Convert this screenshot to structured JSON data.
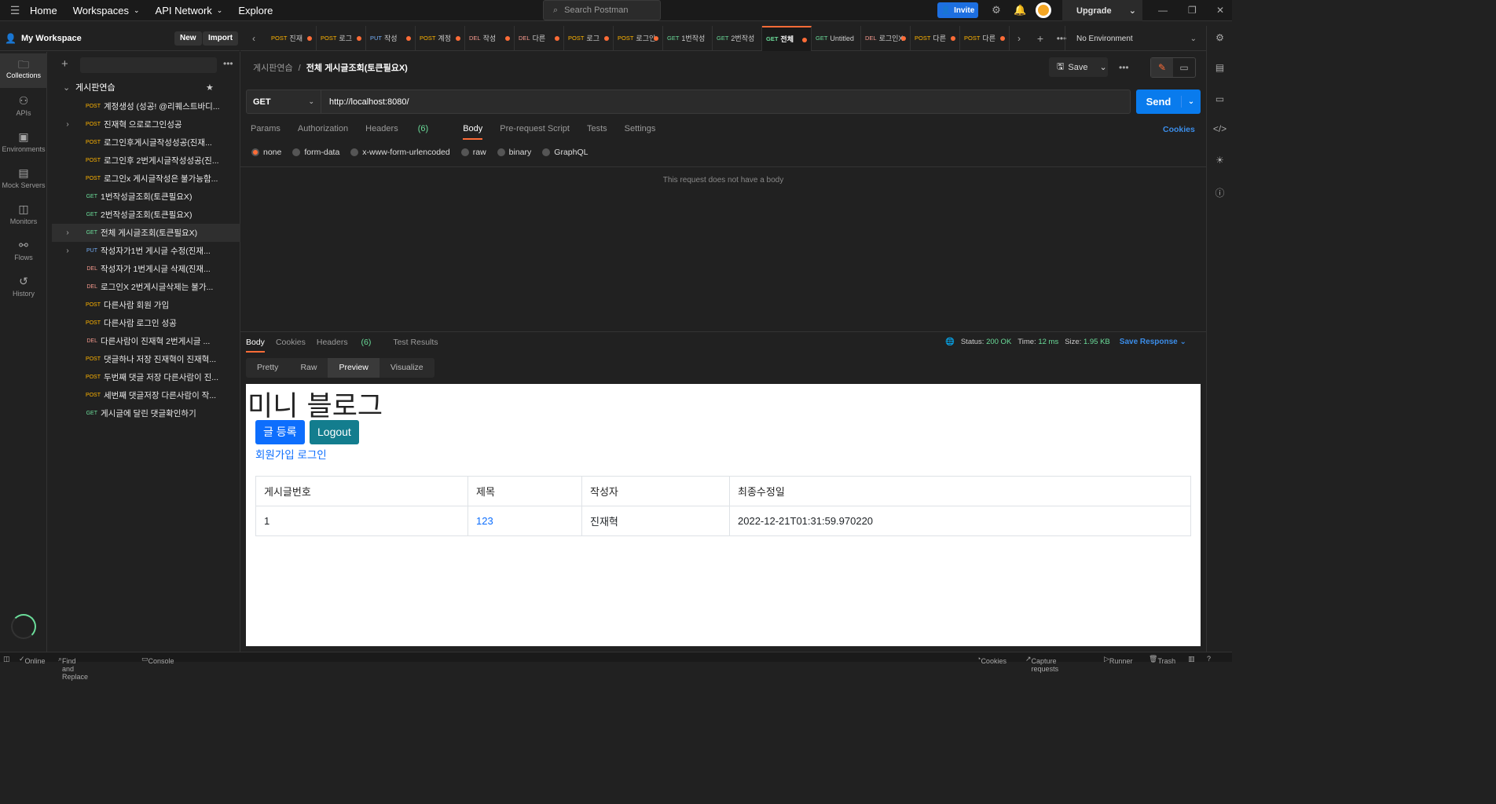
{
  "topbar": {
    "home": "Home",
    "workspaces": "Workspaces",
    "api_network": "API Network",
    "explore": "Explore",
    "search_placeholder": "Search Postman",
    "invite": "Invite",
    "upgrade": "Upgrade"
  },
  "workspace": {
    "name": "My Workspace",
    "new_label": "New",
    "import_label": "Import"
  },
  "leftnav": [
    {
      "label": "Collections",
      "icon": "collections-icon"
    },
    {
      "label": "APIs",
      "icon": "apis-icon"
    },
    {
      "label": "Environments",
      "icon": "environments-icon"
    },
    {
      "label": "Mock Servers",
      "icon": "mock-servers-icon"
    },
    {
      "label": "Monitors",
      "icon": "monitors-icon"
    },
    {
      "label": "Flows",
      "icon": "flows-icon"
    },
    {
      "label": "History",
      "icon": "history-icon"
    }
  ],
  "collection": {
    "name": "게시판연습",
    "requests": [
      {
        "method": "POST",
        "name": "계정생성 (성공! @리퀘스트바디..."
      },
      {
        "method": "POST",
        "name": "진재혁 으로로그인성공",
        "expand": true
      },
      {
        "method": "POST",
        "name": "로그인후게시글작성성공(진재..."
      },
      {
        "method": "POST",
        "name": "로그인후 2번게시글작성성공(진..."
      },
      {
        "method": "POST",
        "name": "로그인x 게시글작성은 불가능함..."
      },
      {
        "method": "GET",
        "name": "1번작성글조회(토큰필요X)"
      },
      {
        "method": "GET",
        "name": "2번작성글조회(토큰필요X)"
      },
      {
        "method": "GET",
        "name": "전체 게시글조회(토큰필요X)",
        "expand": true,
        "active": true
      },
      {
        "method": "PUT",
        "name": "작성자가1번 게시글 수정(진재...",
        "expand": true
      },
      {
        "method": "DEL",
        "name": "작성자가 1번게시글 삭제(진재..."
      },
      {
        "method": "DEL",
        "name": "로그인X 2번게시글삭제는 불가..."
      },
      {
        "method": "POST",
        "name": "다른사람 회원 가입"
      },
      {
        "method": "POST",
        "name": "다른사람 로그인 성공"
      },
      {
        "method": "DEL",
        "name": "다른사람이 진재혁 2번게시글 ..."
      },
      {
        "method": "POST",
        "name": "댓글하나 저장 진재혁이 진재혁..."
      },
      {
        "method": "POST",
        "name": "두번째 댓글 저장 다른사람이 진..."
      },
      {
        "method": "POST",
        "name": "세번째 댓글저장 다른사람이 작..."
      },
      {
        "method": "GET",
        "name": "게시글에 달린 댓글확인하기"
      }
    ]
  },
  "tabs": [
    {
      "method": "POST",
      "name": "진재"
    },
    {
      "method": "POST",
      "name": "로그"
    },
    {
      "method": "PUT",
      "name": "작성"
    },
    {
      "method": "POST",
      "name": "계정"
    },
    {
      "method": "DEL",
      "name": "작성"
    },
    {
      "method": "DEL",
      "name": "다른"
    },
    {
      "method": "POST",
      "name": "로그"
    },
    {
      "method": "POST",
      "name": "로그인"
    },
    {
      "method": "GET",
      "name": "1번작성"
    },
    {
      "method": "GET",
      "name": "2번작성"
    },
    {
      "method": "GET",
      "name": "전체",
      "active": true
    },
    {
      "method": "GET",
      "name": "Untitled"
    },
    {
      "method": "DEL",
      "name": "로그인X"
    },
    {
      "method": "POST",
      "name": "다른"
    },
    {
      "method": "POST",
      "name": "다른"
    }
  ],
  "environment": "No Environment",
  "request": {
    "breadcrumb_parent": "게시판연습",
    "breadcrumb_sep": "/",
    "title": "전체 게시글조회(토큰필요X)",
    "save": "Save",
    "method": "GET",
    "url": "http://localhost:8080/",
    "send": "Send",
    "tabs": {
      "params": "Params",
      "authorization": "Authorization",
      "headers": "Headers",
      "headers_count": "(6)",
      "body": "Body",
      "prerequest": "Pre-request Script",
      "tests": "Tests",
      "settings": "Settings"
    },
    "cookies": "Cookies",
    "body_types": [
      "none",
      "form-data",
      "x-www-form-urlencoded",
      "raw",
      "binary",
      "GraphQL"
    ],
    "no_body_text": "This request does not have a body"
  },
  "response": {
    "tabs": {
      "body": "Body",
      "cookies": "Cookies",
      "headers": "Headers",
      "headers_count": "(6)",
      "test_results": "Test Results"
    },
    "status_label": "Status:",
    "status": "200 OK",
    "time_label": "Time:",
    "time": "12 ms",
    "size_label": "Size:",
    "size": "1.95 KB",
    "save_response": "Save Response",
    "view_tabs": [
      "Pretty",
      "Raw",
      "Preview",
      "Visualize"
    ],
    "preview": {
      "heading": "미니 블로그",
      "btn_write": "글 등록",
      "btn_logout": "Logout",
      "link_signup": "회원가입",
      "link_login": "로그인",
      "headers": [
        "게시글번호",
        "제목",
        "작성자",
        "최종수정일"
      ],
      "row": [
        "1",
        "123",
        "진재혁",
        "2022-12-21T01:31:59.970220"
      ]
    }
  },
  "footer": {
    "online": "Online",
    "find_replace": "Find and Replace",
    "console": "Console",
    "cookies": "Cookies",
    "capture": "Capture requests",
    "runner": "Runner",
    "trash": "Trash"
  }
}
